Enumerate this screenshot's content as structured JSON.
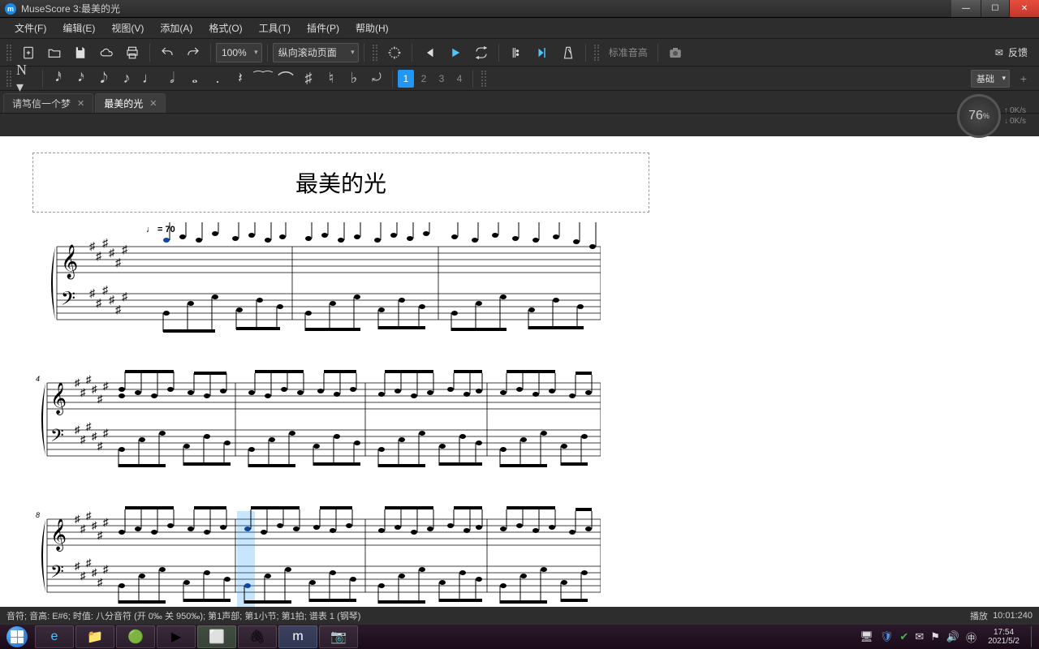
{
  "titlebar": {
    "app": "MuseScore 3",
    "document": "最美的光"
  },
  "menu": {
    "items": [
      "文件(F)",
      "编辑(E)",
      "视图(V)",
      "添加(A)",
      "格式(O)",
      "工具(T)",
      "插件(P)",
      "帮助(H)"
    ]
  },
  "toolbar": {
    "zoom": "100%",
    "scroll_mode": "纵向滚动页面",
    "concert_pitch": "标准音高",
    "feedback_label": "反馈"
  },
  "voices": [
    "1",
    "2",
    "3",
    "4"
  ],
  "right_panel": {
    "label": "基础"
  },
  "tabs": [
    {
      "label": "请笃信一个梦",
      "active": false
    },
    {
      "label": "最美的光",
      "active": true
    }
  ],
  "dial": {
    "value": "76",
    "unit": "%",
    "up": "0K/s",
    "down": "0K/s"
  },
  "score": {
    "title": "最美的光",
    "tempo": "♩ = 70"
  },
  "status": {
    "left": "音符; 音高: E#6; 时值: 八分音符 (开 0‰ 关 950‰); 第1声部;   第1小节; 第1拍; 谱表 1 (钢琴)",
    "right_label": "播放",
    "right_time": "10:01:240"
  },
  "taskbar": {
    "clock_time": "17:54",
    "clock_date": "2021/5/2"
  }
}
